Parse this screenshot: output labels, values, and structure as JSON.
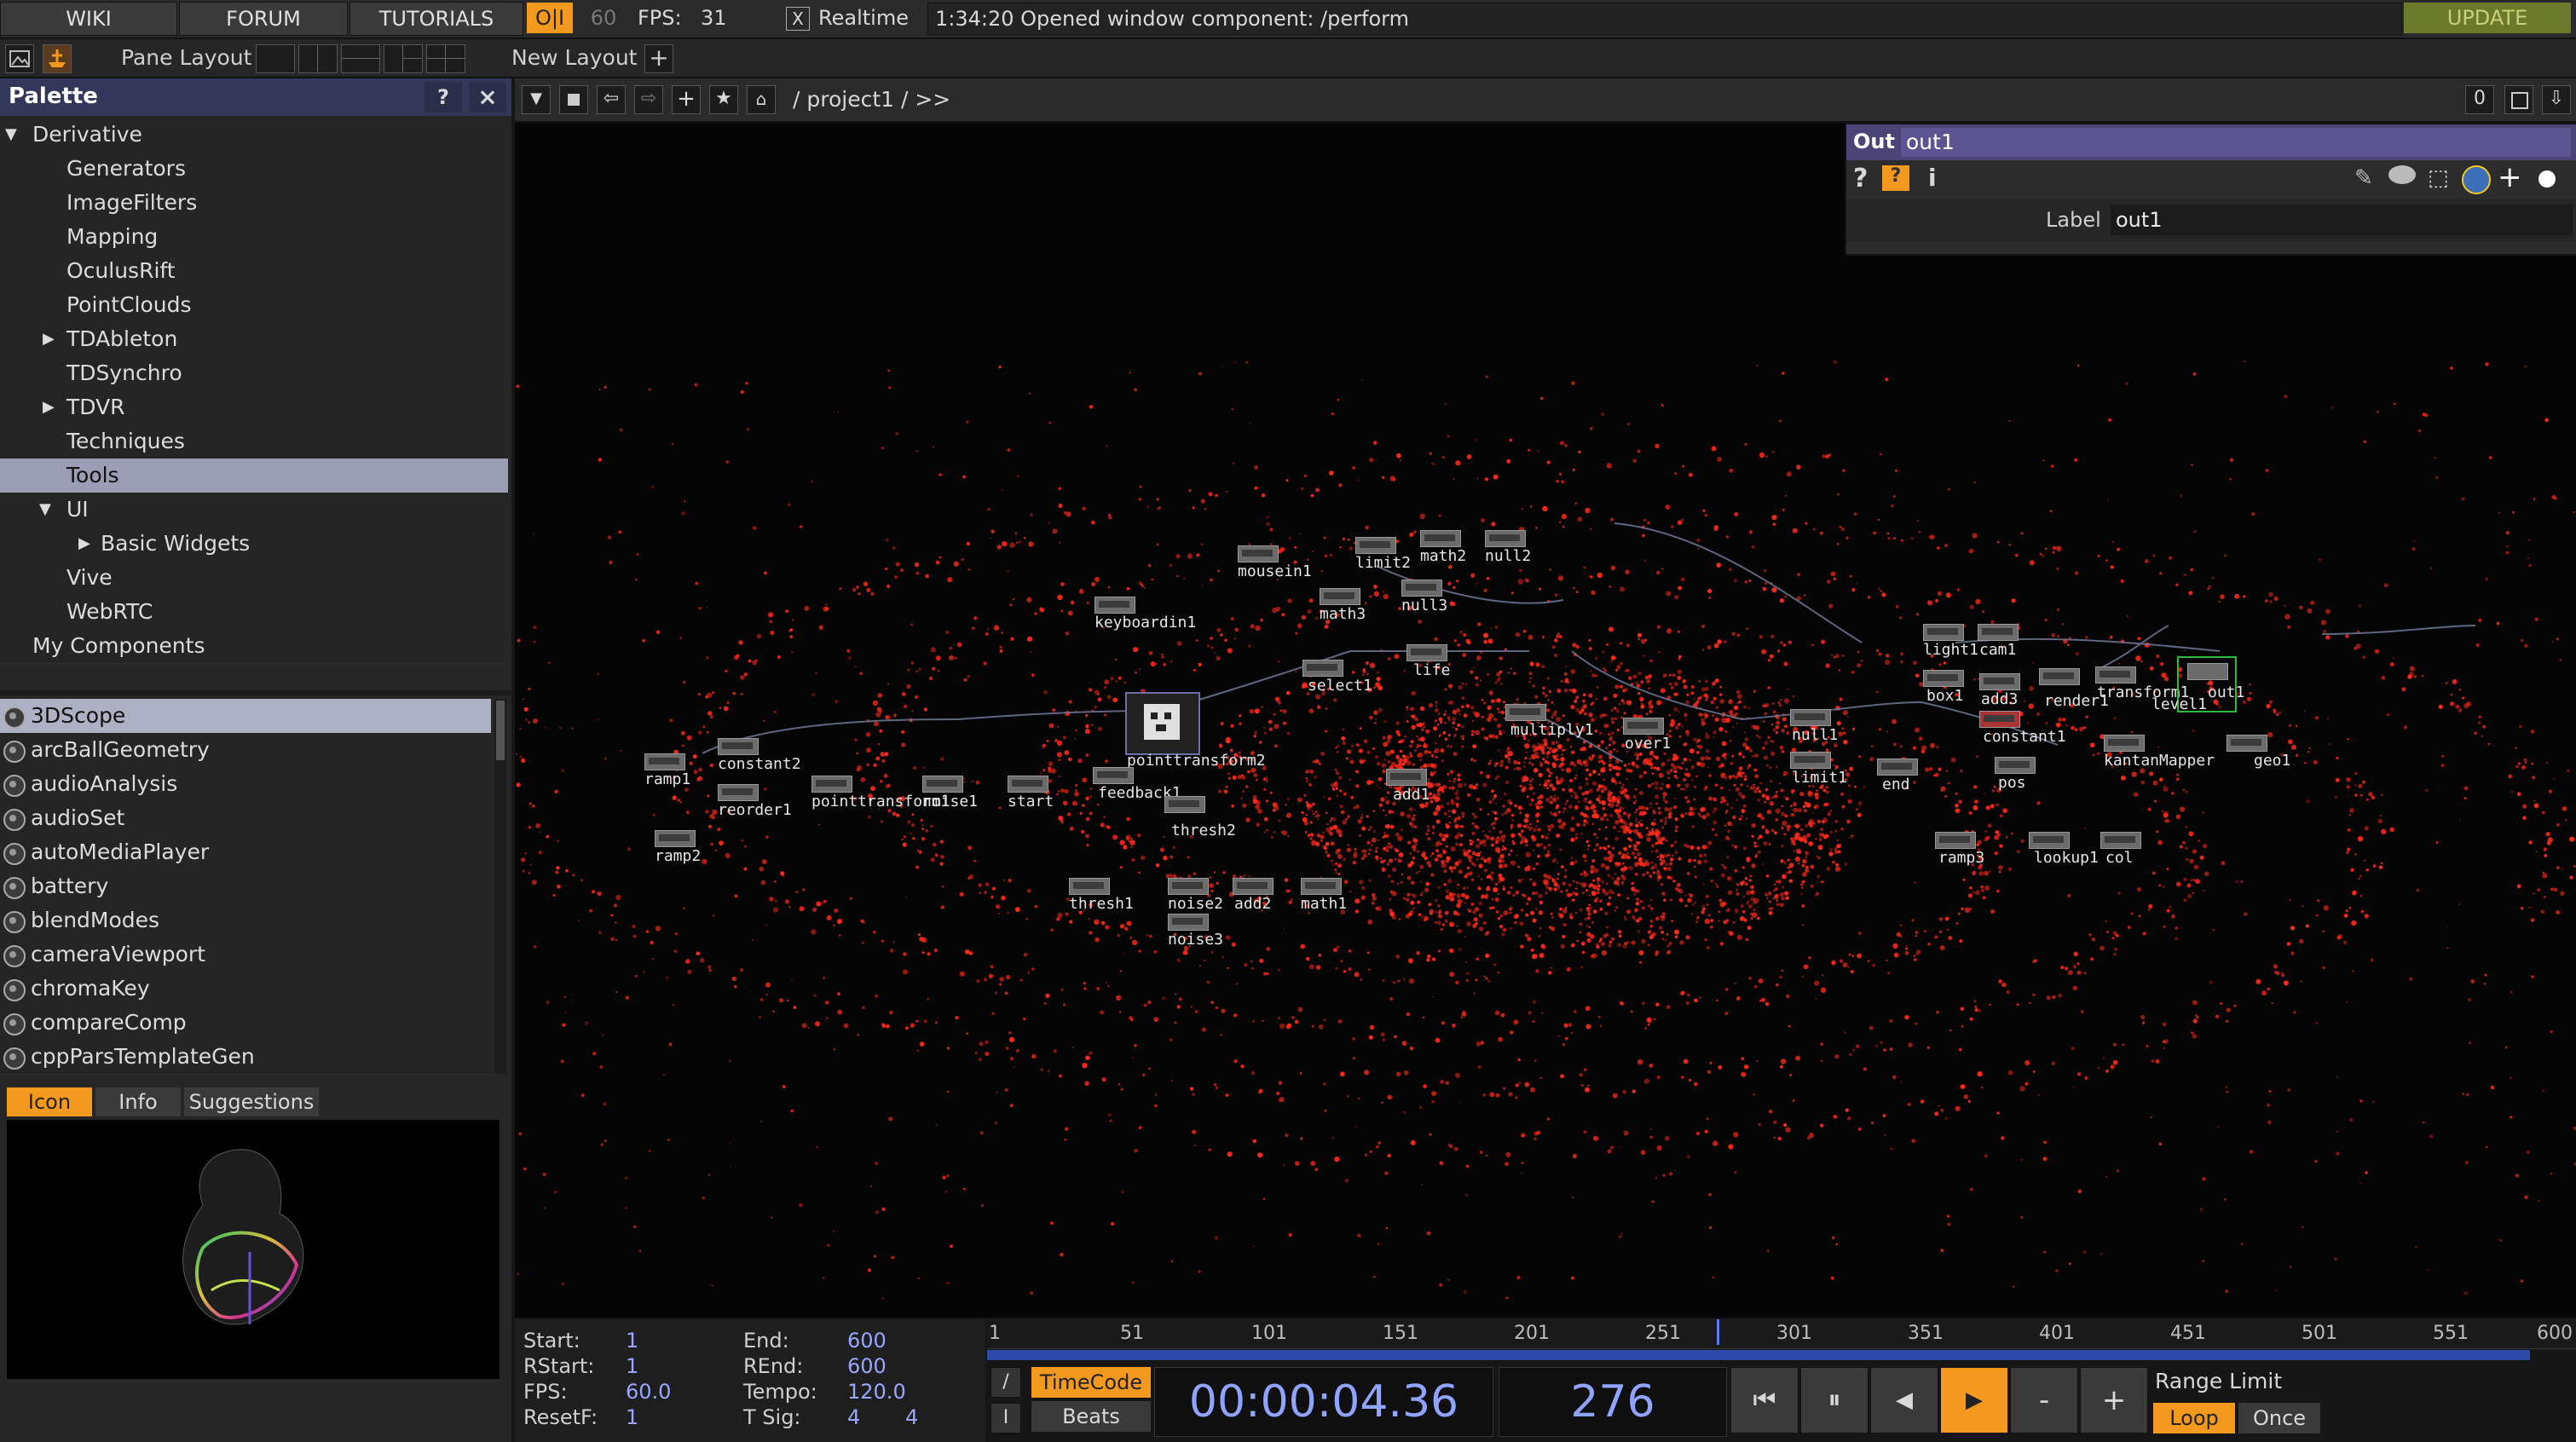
{
  "top": {
    "wiki": "WIKI",
    "forum": "FORUM",
    "tutorials": "TUTORIALS",
    "oi": "O|I",
    "fps_target": "60",
    "fps_label": "FPS:",
    "fps_value": "31",
    "realtime_check": "X",
    "realtime_label": "Realtime",
    "status": "1:34:20 Opened window component: /perform",
    "update": "UPDATE"
  },
  "second": {
    "pane_layout": "Pane Layout",
    "new_layout": "New Layout",
    "plus": "+"
  },
  "palette": {
    "title": "Palette",
    "help": "?",
    "close": "×",
    "tree": [
      {
        "label": "Derivative"
      },
      {
        "label": "Generators"
      },
      {
        "label": "ImageFilters"
      },
      {
        "label": "Mapping"
      },
      {
        "label": "OculusRift"
      },
      {
        "label": "PointClouds"
      },
      {
        "label": "TDAbleton"
      },
      {
        "label": "TDSynchro"
      },
      {
        "label": "TDVR"
      },
      {
        "label": "Techniques"
      },
      {
        "label": "Tools"
      },
      {
        "label": "UI"
      },
      {
        "label": "Basic Widgets"
      },
      {
        "label": "Vive"
      },
      {
        "label": "WebRTC"
      },
      {
        "label": "My Components"
      }
    ],
    "components": [
      "3DScope",
      "arcBallGeometry",
      "audioAnalysis",
      "audioSet",
      "autoMediaPlayer",
      "battery",
      "blendModes",
      "cameraViewport",
      "chromaKey",
      "compareComp",
      "cppParsTemplateGen"
    ],
    "tabs": {
      "icon": "Icon",
      "info": "Info",
      "suggestions": "Suggestions"
    }
  },
  "network": {
    "path": "/ project1 / >>",
    "count": "0",
    "nodes": [
      "mousein1",
      "limit2",
      "math2",
      "null2",
      "keyboardin1",
      "math3",
      "null3",
      "life",
      "select1",
      "multiply1",
      "over1",
      "null1",
      "limit1",
      "end",
      "pointtransform2",
      "constant2",
      "ramp1",
      "reorder1",
      "pointtransform1",
      "noise1",
      "start",
      "feedback1",
      "add1",
      "thresh2",
      "ramp2",
      "thresh1",
      "noise2",
      "add2",
      "math1",
      "noise3",
      "light1",
      "cam1",
      "box1",
      "add3",
      "render1",
      "transform1",
      "constant1",
      "pos",
      "ramp3",
      "lookup1",
      "col",
      "kantanMapper",
      "geo1",
      "out1",
      "level1"
    ]
  },
  "param": {
    "type": "Out",
    "name": "out1",
    "label_key": "Label",
    "label_value": "out1"
  },
  "timeline": {
    "start_lbl": "Start:",
    "start": "1",
    "end_lbl": "End:",
    "end": "600",
    "rstart_lbl": "RStart:",
    "rstart": "1",
    "rend_lbl": "REnd:",
    "rend": "600",
    "fps_lbl": "FPS:",
    "fps": "60.0",
    "tempo_lbl": "Tempo:",
    "tempo": "120.0",
    "resetf_lbl": "ResetF:",
    "resetf": "1",
    "tsig_lbl": "T Sig:",
    "tsig_a": "4",
    "tsig_b": "4",
    "ticks": [
      "1",
      "51",
      "101",
      "151",
      "201",
      "251",
      "301",
      "351",
      "401",
      "451",
      "501",
      "551",
      "600"
    ],
    "current_frame_value": 276,
    "timecode_btn": "TimeCode",
    "beats_btn": "Beats",
    "timecode": "00:00:04.36",
    "frame": "276",
    "range_limit": "Range Limit",
    "loop": "Loop",
    "once": "Once",
    "slash": "/",
    "i_btn": "I",
    "minus": "-",
    "plus": "+"
  },
  "colors": {
    "accent": "#f39a1e",
    "particles": "#ff2a1a",
    "palette_head": "#33375a",
    "param_head": "#4a4477"
  }
}
